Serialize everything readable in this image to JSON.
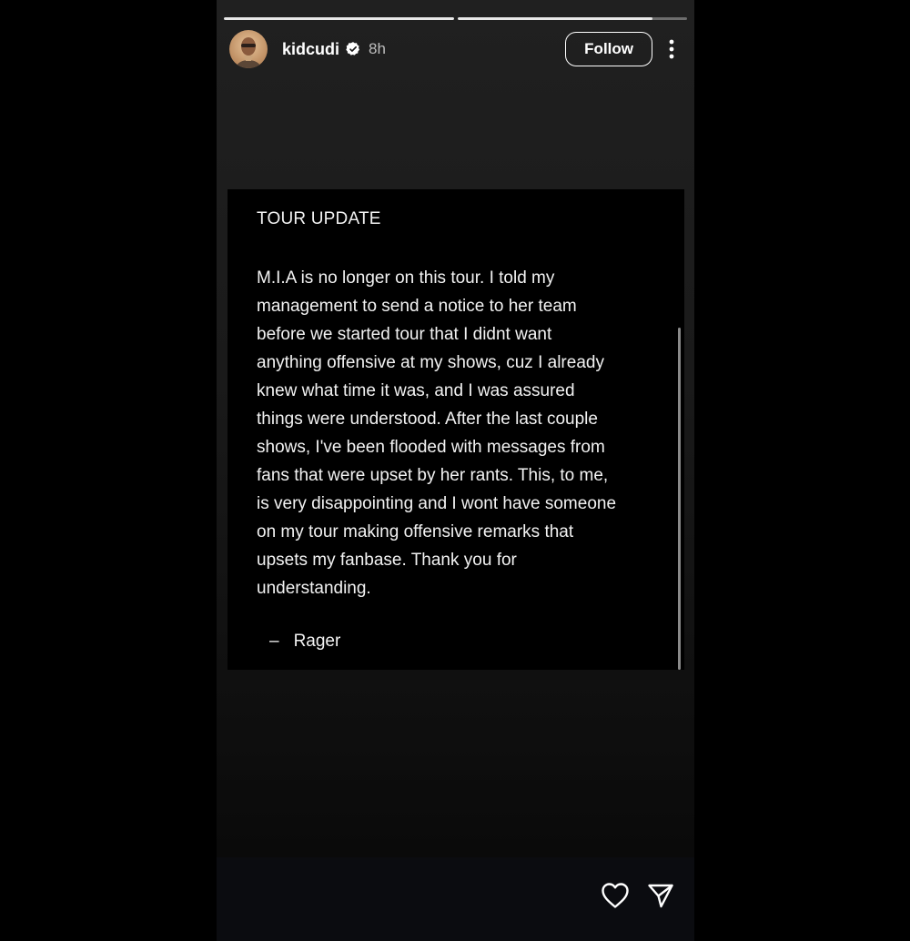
{
  "story": {
    "progress": [
      1.0,
      0.85
    ],
    "user": {
      "username": "kidcudi",
      "verified": true,
      "time_ago": "8h",
      "avatar_icon": "avatar-photo"
    },
    "header": {
      "follow_label": "Follow",
      "more_icon": "more-vertical-icon"
    },
    "note": {
      "title": "TOUR UPDATE",
      "body": "M.I.A is no longer on this tour.  I told my\nmanagement to send a notice to her team\nbefore we started tour that I didnt want\nanything offensive at my shows, cuz I already\nknew what time it was, and I was assured\nthings were understood.  After the last couple\nshows, I've been flooded with messages from\nfans that were upset by her rants.  This, to me,\nis very disappointing and I wont have someone\non my tour making offensive remarks that\nupsets my fanbase.  Thank you for\nunderstanding.",
      "sign_dash": "–",
      "signature": "Rager"
    },
    "footer": {
      "like_icon": "heart-icon",
      "share_icon": "send-icon"
    },
    "colors": {
      "background": "#000000",
      "text": "#f2f2f2",
      "meta": "#bdbdbd"
    }
  }
}
